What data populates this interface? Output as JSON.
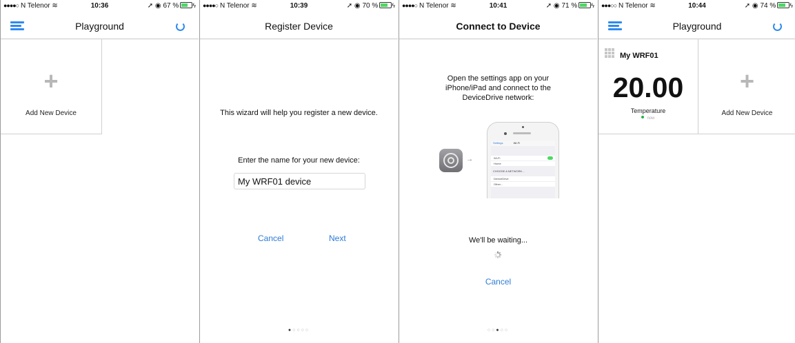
{
  "screens": [
    {
      "status": {
        "carrier": "N Telenor",
        "signal_dots": "●●●●○",
        "time": "10:36",
        "battery": "67 %"
      },
      "nav": {
        "title": "Playground"
      },
      "tile": {
        "plus": "+",
        "label": "Add New Device"
      }
    },
    {
      "status": {
        "carrier": "N Telenor",
        "signal_dots": "●●●●○",
        "time": "10:39",
        "battery": "70 %"
      },
      "nav": {
        "title": "Register Device"
      },
      "intro": "This wizard will help you register a new device.",
      "prompt": "Enter the name for your new device:",
      "name_value": "My WRF01 device",
      "cancel": "Cancel",
      "next": "Next",
      "pager": {
        "active": "●",
        "inactive": "○○○○"
      }
    },
    {
      "status": {
        "carrier": "N Telenor",
        "signal_dots": "●●●●○",
        "time": "10:41",
        "battery": "71 %"
      },
      "nav": {
        "title": "Connect to Device"
      },
      "instructions": "Open the settings app on your iPhone/iPad and connect to the DeviceDrive network:",
      "phone": {
        "back": "Settings",
        "header": "Wi-Fi",
        "wifi": "Wi-Fi",
        "home": "Home",
        "choose": "CHOOSE A NETWORK...",
        "network": "DeviceDrive",
        "other": "Other..."
      },
      "arrow": "→",
      "waiting": "We'll be waiting...",
      "cancel": "Cancel",
      "pager": {
        "before": "○○",
        "active": "●",
        "after": "○○"
      }
    },
    {
      "status": {
        "carrier": "N Telenor",
        "signal_dots": "●●●○○",
        "time": "10:44",
        "battery": "74 %"
      },
      "nav": {
        "title": "Playground"
      },
      "device": {
        "name": "My WRF01",
        "value": "20.00",
        "measure": "Temperature",
        "state": "now"
      },
      "tile": {
        "plus": "+",
        "label": "Add New Device"
      }
    }
  ],
  "colors": {
    "accent": "#2d8af1",
    "link": "#2d7bd6",
    "battery": "#4cd964",
    "online": "#27b34a"
  },
  "icons": [
    "menu-icon",
    "refresh-icon",
    "plus-icon",
    "wifi-icon",
    "location-arrow-icon",
    "alarm-icon",
    "battery-icon",
    "settings-app-icon",
    "spinner-icon",
    "grid-icon"
  ]
}
